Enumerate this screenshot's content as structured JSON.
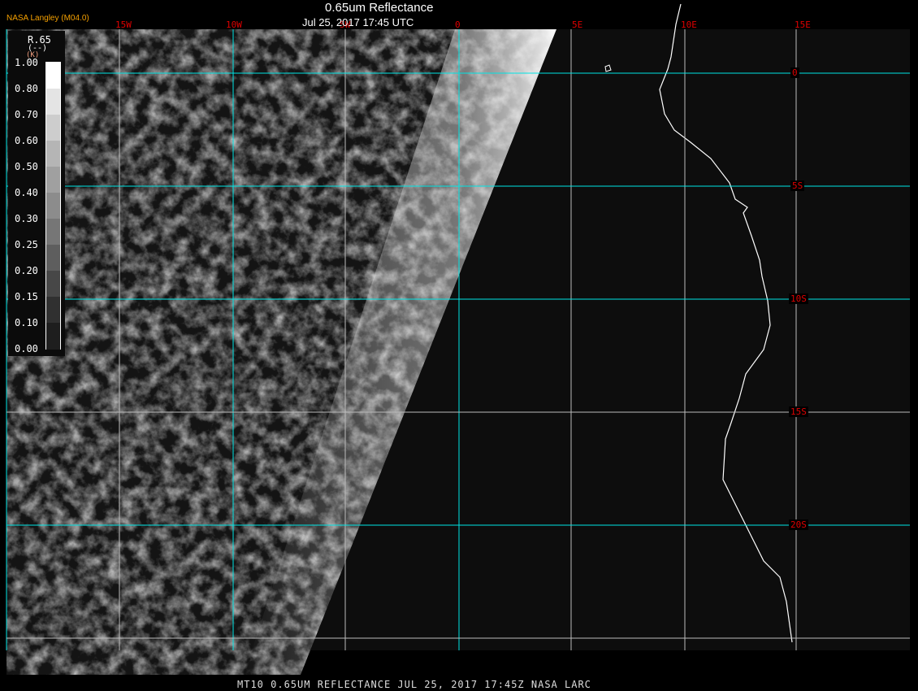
{
  "header": {
    "title": "0.65um Reflectance",
    "datetime": "Jul 25, 2017 17:45 UTC",
    "agency": "NASA Langley (M04.0)"
  },
  "longitude_labels": [
    "15W",
    "10W",
    "5W",
    "0",
    "5E",
    "10E",
    "15E"
  ],
  "latitude_labels": [
    "0",
    "5S",
    "10S",
    "15S",
    "20S"
  ],
  "legend": {
    "name": "R.65",
    "units": "(--)",
    "sub": "(K)",
    "values": [
      "1.00",
      "0.80",
      "0.70",
      "0.60",
      "0.50",
      "0.40",
      "0.30",
      "0.25",
      "0.20",
      "0.15",
      "0.10",
      "0.00"
    ],
    "colors": [
      "#ffffff",
      "#e4e4e4",
      "#cdcdcd",
      "#b5b5b5",
      "#a0a0a0",
      "#8c8c8c",
      "#767676",
      "#5e5e5e",
      "#474747",
      "#303030",
      "#1e1e1e",
      "#0c0c0c"
    ]
  },
  "footer": "MT10  0.65UM REFLECTANCE   JUL 25, 2017 17:45Z   NASA LARC"
}
